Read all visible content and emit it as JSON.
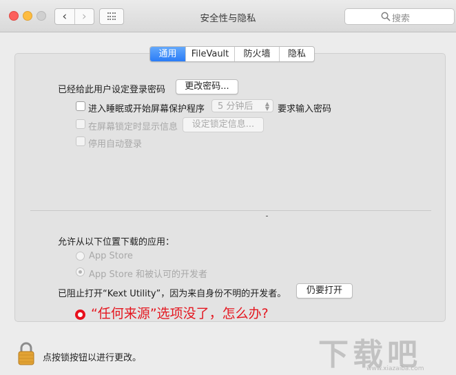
{
  "window": {
    "title": "安全性与隐私",
    "search_placeholder": "搜索"
  },
  "toolbar": {
    "back": "‹",
    "forward": "›"
  },
  "tabs": [
    {
      "label": "通用",
      "active": true
    },
    {
      "label": "FileVault",
      "active": false
    },
    {
      "label": "防火墙",
      "active": false
    },
    {
      "label": "隐私",
      "active": false
    }
  ],
  "general": {
    "password_label": "已经给此用户设定登录密码",
    "change_password_button": "更改密码...",
    "sleep_checkbox_label": "进入睡眠或开始屏幕保护程序",
    "sleep_delay_value": "5 分钟后",
    "require_password_label": "要求输入密码",
    "lock_message_checkbox_label": "在屏幕锁定时显示信息",
    "lock_message_button": "设定锁定信息...",
    "auto_login_checkbox_label": "停用自动登录"
  },
  "downloads": {
    "heading": "允许从以下位置下载的应用：",
    "options": [
      {
        "label": "App Store",
        "selected": false
      },
      {
        "label": "App Store 和被认可的开发者",
        "selected": true
      }
    ],
    "blocked_message": "已阻止打开“Kext Utility”，因为来自身份不明的开发者。",
    "open_anyway_button": "仍要打开"
  },
  "annotation": {
    "text": "“任何来源”选项没了，怎么办?",
    "color": "#e4161f"
  },
  "footer": {
    "lock_text": "点按锁按钮以进行更改。"
  },
  "watermark": {
    "logo_text": "下载吧",
    "url": "www.xiazaiba.com"
  },
  "colors": {
    "tab_active": "#2b7df7",
    "close": "#fc605c",
    "minimize": "#fdbc40"
  }
}
